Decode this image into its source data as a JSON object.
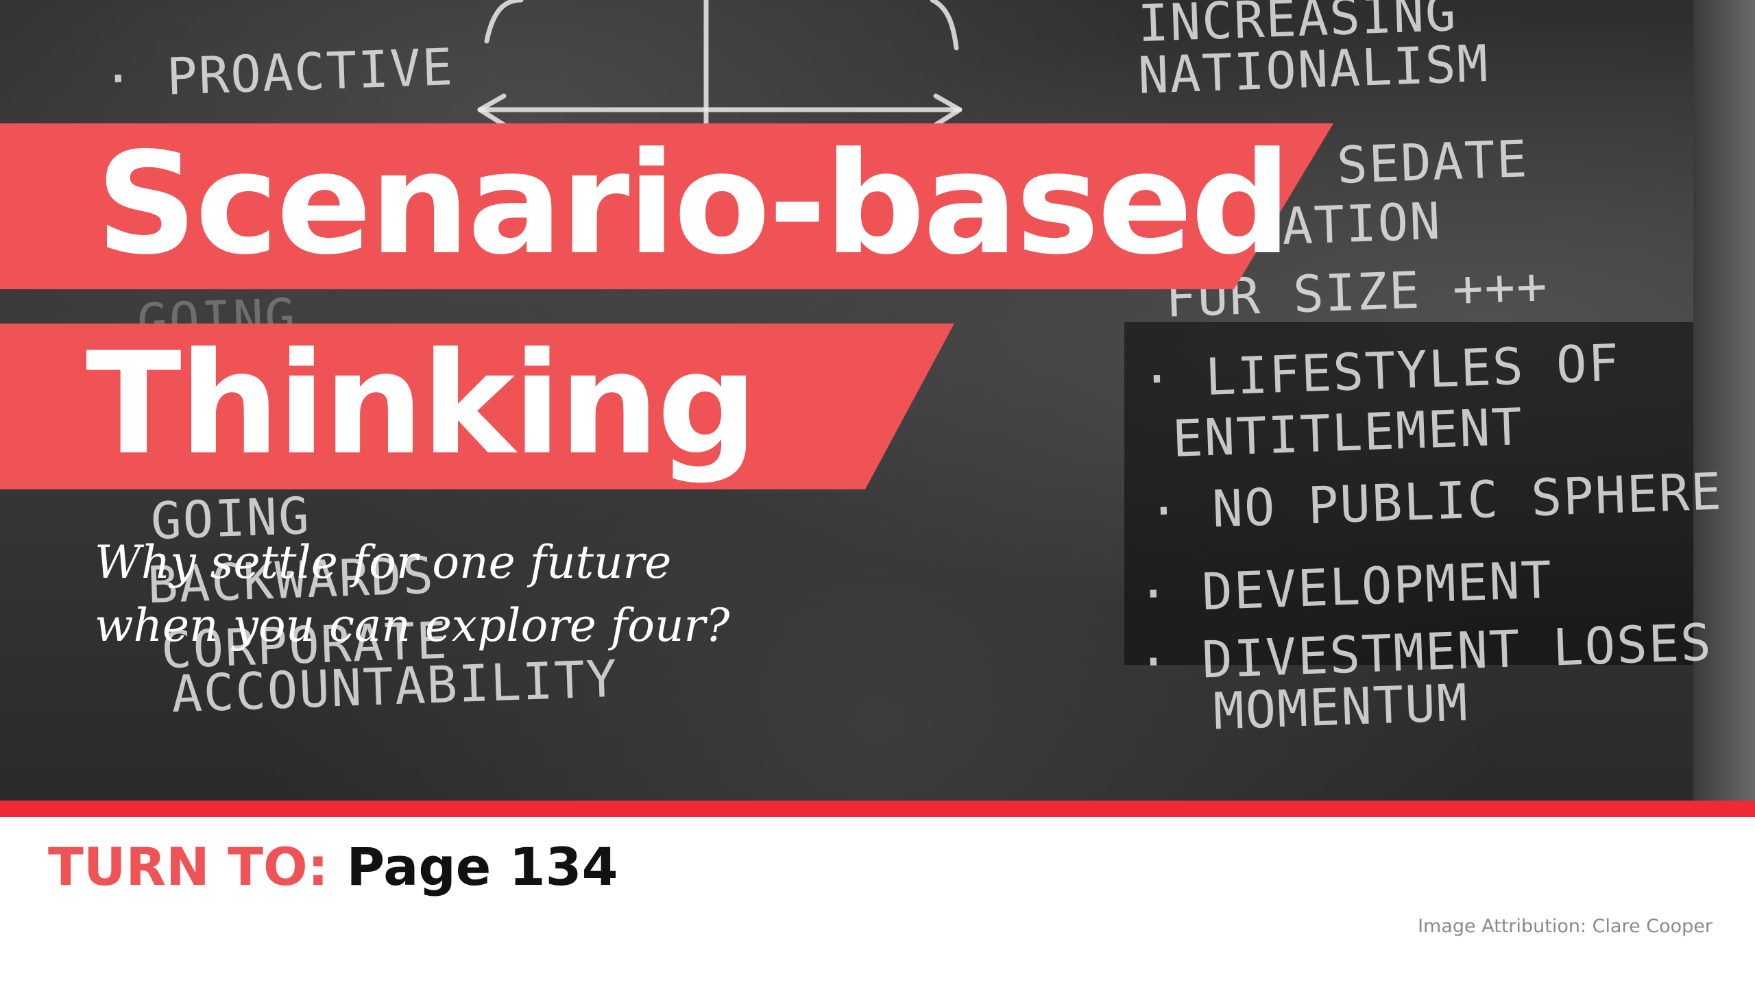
{
  "slide": {
    "title_line1": "Scenario-based",
    "title_line2": "Thinking",
    "subtitle_line1": "Why settle for one future",
    "subtitle_line2": "when you can explore four?"
  },
  "footer": {
    "turn_to_label": "TURN TO:",
    "page_text": "Page 134",
    "attribution": "Image Attribution: Clare Cooper"
  },
  "background_photo": {
    "chalk_left": [
      "· PROACTIVE",
      "GOING",
      "BACKWARDS",
      "CORPORATE",
      "ACCOUNTABILITY"
    ],
    "chalk_right": [
      "INCREASING",
      "NATIONALISM",
      "SEDATE",
      "ATION",
      "FUR SIZE +++",
      "· LIFESTYLES OF",
      "ENTITLEMENT",
      "· NO PUBLIC SPHERE",
      "· DEVELOPMENT",
      "· DIVESTMENT LOSES",
      "MOMENTUM"
    ]
  },
  "colors": {
    "accent_red": "#ef5356",
    "rule_red": "#ee2b35",
    "title_text": "#ffffff",
    "page_text": "#111111",
    "attribution_text": "#8a8a8a"
  }
}
